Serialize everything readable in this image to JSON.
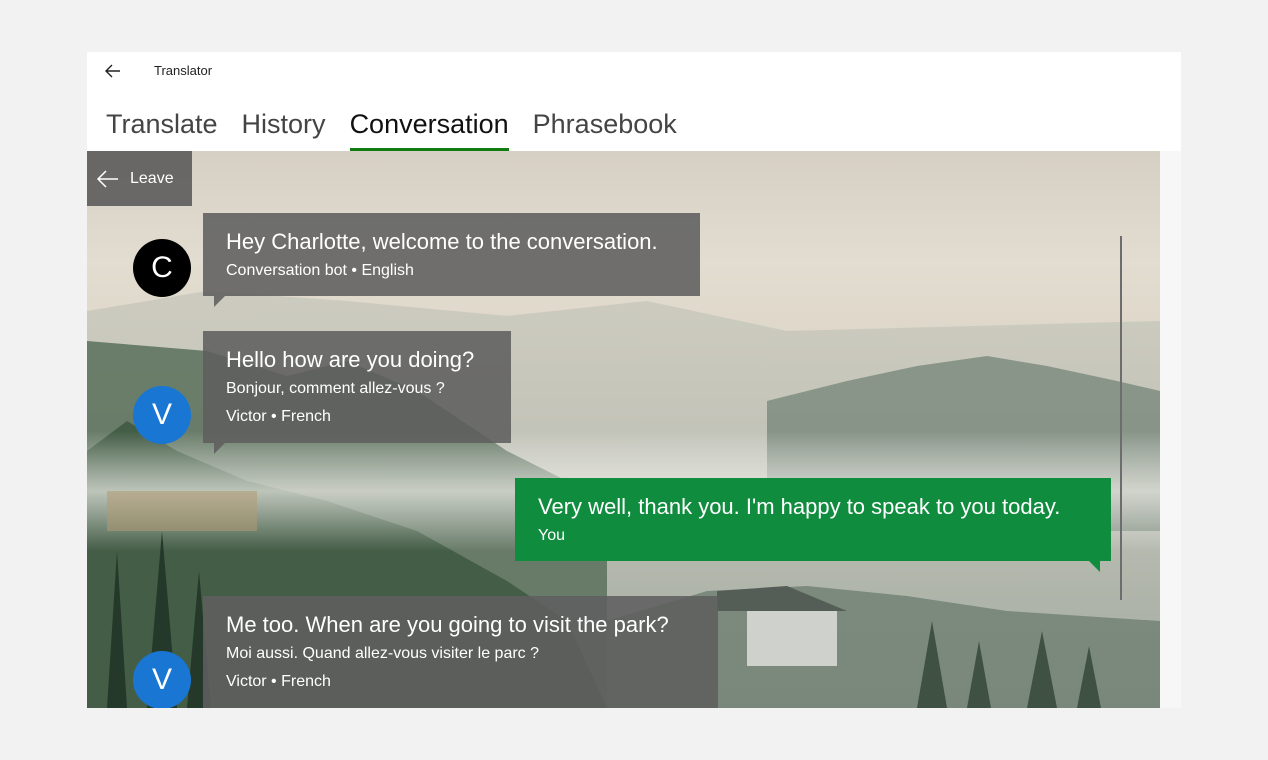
{
  "titlebar": {
    "back_icon": "arrow-left-icon",
    "title": "Translator"
  },
  "tabs": [
    {
      "label": "Translate",
      "active": false
    },
    {
      "label": "History",
      "active": false
    },
    {
      "label": "Conversation",
      "active": true
    },
    {
      "label": "Phrasebook",
      "active": false
    }
  ],
  "accent_color": "#107c10",
  "conversation": {
    "leave_label": "Leave",
    "leave_icon": "arrow-left-icon",
    "messages": [
      {
        "avatar": "C",
        "avatar_color": "#000000",
        "text": "Hey Charlotte, welcome to the conversation.",
        "meta": "Conversation bot • English"
      },
      {
        "avatar": "V",
        "avatar_color": "#1976d2",
        "text": "Hello how are you doing?",
        "translation": "Bonjour, comment allez-vous ?",
        "meta": "Victor • French"
      },
      {
        "text": "Very well, thank you. I'm happy to speak to you today.",
        "meta": "You",
        "bubble_color": "#108c3e"
      },
      {
        "avatar": "V",
        "avatar_color": "#1976d2",
        "text": "Me too. When are you going to visit the park?",
        "translation": "Moi aussi. Quand allez-vous visiter le parc ?",
        "meta": "Victor • French"
      }
    ]
  }
}
